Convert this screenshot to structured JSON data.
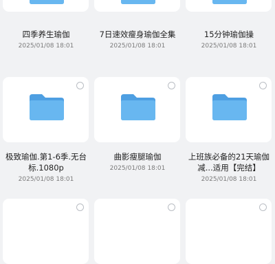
{
  "items": [
    {
      "title": "四季养生瑜伽",
      "date": "2025/01/08 18:01"
    },
    {
      "title": "7日速效瘦身瑜伽全集",
      "date": "2025/01/08 18:01"
    },
    {
      "title": "15分钟瑜伽操",
      "date": "2025/01/08 18:01"
    },
    {
      "title": "极致瑜伽.第1-6季.无台标.1080p",
      "date": "2025/01/08 18:01"
    },
    {
      "title": "曲影瘦腿瑜伽",
      "date": "2025/01/08 18:01"
    },
    {
      "title": "上班族必备的21天瑜伽减...适用【完结】",
      "date": "2025/01/08 18:01"
    }
  ],
  "colors": {
    "folder": "#62b2ee",
    "folder_back": "#4e9fe2",
    "background": "#f1f2f4"
  }
}
